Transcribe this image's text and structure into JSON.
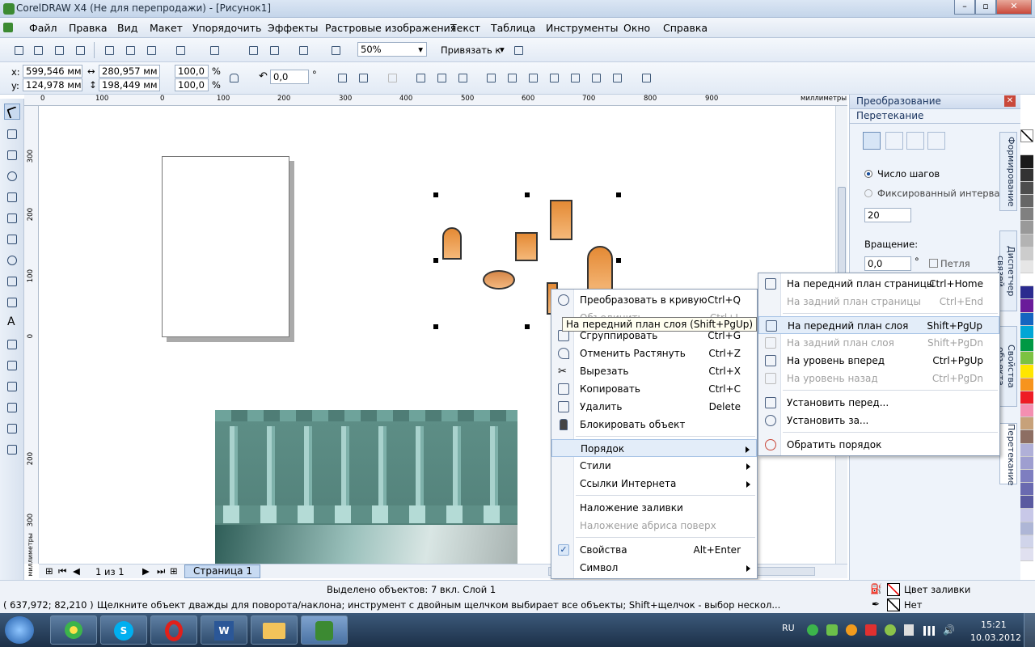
{
  "window": {
    "title": "CorelDRAW X4 (Не для перепродажи) - [Рисунок1]"
  },
  "menu": [
    "Файл",
    "Правка",
    "Вид",
    "Макет",
    "Упорядочить",
    "Эффекты",
    "Растровые изображения",
    "Текст",
    "Таблица",
    "Инструменты",
    "Окно",
    "Справка"
  ],
  "toolbar": {
    "zoom": "50%",
    "snap_label": "Привязать к"
  },
  "props": {
    "x_label": "x:",
    "x_value": "599,546 мм",
    "y_label": "y:",
    "y_value": "124,978 мм",
    "w_value": "280,957 мм",
    "h_value": "198,449 мм",
    "sx": "100,0",
    "sy": "100,0",
    "pct": "%",
    "rotation": "0,0",
    "deg": "°"
  },
  "ruler": {
    "unit": "миллиметры",
    "top_ticks": [
      "0",
      "100",
      "0",
      "100",
      "200",
      "300",
      "400",
      "500",
      "600",
      "700",
      "800",
      "900"
    ],
    "left_ticks": [
      "300",
      "200",
      "100",
      "0",
      "100",
      "200",
      "300"
    ],
    "left_unit": "миллиметры"
  },
  "page_nav": {
    "page_of": "1 из 1",
    "page_tab": "Страница 1"
  },
  "docker": {
    "title1": "Преобразование",
    "title2": "Перетекание",
    "opt_steps": "Число шагов",
    "opt_interval": "Фиксированный интервал",
    "steps_value": "20",
    "rotation_label": "Вращение:",
    "rotation_value": "0,0",
    "deg": "°",
    "loop_label": "Петля"
  },
  "vtabs": [
    "Формирование",
    "Диспетчер связей",
    "Свойства объекта",
    "Перетекание"
  ],
  "context_menu": {
    "items": [
      {
        "label": "Преобразовать в кривую",
        "key": "Ctrl+Q",
        "disabled": false
      },
      {
        "label": "Объединить",
        "key": "Ctrl+L",
        "disabled": true
      },
      {
        "label": "Сгруппировать",
        "key": "Ctrl+G",
        "disabled": false
      },
      {
        "label": "Отменить Растянуть",
        "key": "Ctrl+Z",
        "disabled": false
      },
      {
        "label": "Вырезать",
        "key": "Ctrl+X",
        "disabled": false
      },
      {
        "label": "Копировать",
        "key": "Ctrl+C",
        "disabled": false
      },
      {
        "label": "Удалить",
        "key": "Delete",
        "disabled": false
      },
      {
        "label": "Блокировать объект",
        "key": "",
        "disabled": false
      },
      {
        "label": "Порядок",
        "key": "",
        "disabled": false
      },
      {
        "label": "Стили",
        "key": "",
        "disabled": false
      },
      {
        "label": "Ссылки Интернета",
        "key": "",
        "disabled": false
      },
      {
        "label": "Наложение заливки",
        "key": "",
        "disabled": false
      },
      {
        "label": "Наложение абриса поверх",
        "key": "",
        "disabled": true
      },
      {
        "label": "Свойства",
        "key": "Alt+Enter",
        "disabled": false
      },
      {
        "label": "Символ",
        "key": "",
        "disabled": false
      }
    ]
  },
  "submenu": {
    "items": [
      {
        "label": "На передний план страницы",
        "key": "Ctrl+Home",
        "disabled": false
      },
      {
        "label": "На задний план страницы",
        "key": "Ctrl+End",
        "disabled": true
      },
      {
        "label": "На передний план слоя",
        "key": "Shift+PgUp",
        "disabled": false
      },
      {
        "label": "На задний план слоя",
        "key": "Shift+PgDn",
        "disabled": true
      },
      {
        "label": "На уровень вперед",
        "key": "Ctrl+PgUp",
        "disabled": false
      },
      {
        "label": "На уровень назад",
        "key": "Ctrl+PgDn",
        "disabled": true
      },
      {
        "label": "Установить перед...",
        "key": "",
        "disabled": false
      },
      {
        "label": "Установить за...",
        "key": "",
        "disabled": false
      },
      {
        "label": "Обратить порядок",
        "key": "",
        "disabled": false
      }
    ]
  },
  "tooltip": "На передний план слоя (Shift+PgUp)",
  "status": {
    "selection": "Выделено объектов: 7 вкл. Слой 1",
    "coords": "( 637,972; 82,210 )",
    "hint": "Щелкните объект дважды для поворота/наклона; инструмент с двойным щелчком выбирает все объекты; Shift+щелчок - выбор нескол...",
    "fill_label": "Цвет заливки",
    "outline_label": "Нет"
  },
  "taskbar": {
    "lang": "RU",
    "time": "15:21",
    "date": "10.03.2012"
  },
  "palette": [
    "#ffffff",
    "#1a1a1a",
    "#333333",
    "#4d4d4d",
    "#666666",
    "#808080",
    "#999999",
    "#b3b3b3",
    "#cccccc",
    "#e6e6e6",
    "#ffffff",
    "#2b2b8f",
    "#6a1b9a",
    "#1565c0",
    "#00a6d6",
    "#009944",
    "#7cc242",
    "#ffe600",
    "#f7941d",
    "#ee1c25",
    "#f48fb1",
    "#c7a17a",
    "#8d6e63",
    "#b0b0d8",
    "#9e9ed0",
    "#7e7ec0",
    "#6a6ab0",
    "#5a5aa0",
    "#c8c8e8",
    "#aeb6d6",
    "#d0d4ea",
    "#e0e0f0"
  ]
}
